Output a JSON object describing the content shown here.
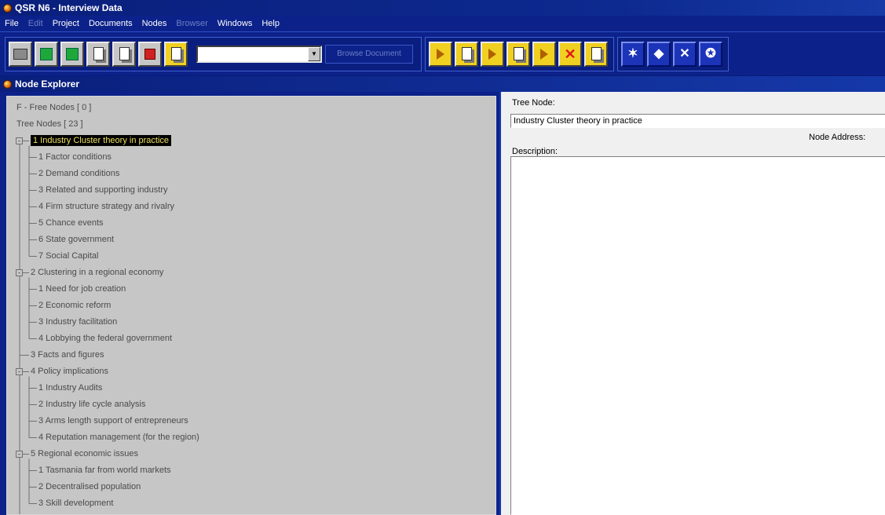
{
  "window": {
    "title": "QSR N6 - Interview Data"
  },
  "menu": [
    {
      "label": "File",
      "enabled": true
    },
    {
      "label": "Edit",
      "enabled": false
    },
    {
      "label": "Project",
      "enabled": true
    },
    {
      "label": "Documents",
      "enabled": true
    },
    {
      "label": "Nodes",
      "enabled": true
    },
    {
      "label": "Browser",
      "enabled": false
    },
    {
      "label": "Windows",
      "enabled": true
    },
    {
      "label": "Help",
      "enabled": true
    }
  ],
  "toolbar": {
    "document_combo_value": "",
    "browse_button_label": "Browse Document"
  },
  "explorer": {
    "title": "Node Explorer",
    "free_nodes": "F - Free Nodes [ 0 ]",
    "tree_nodes": "Tree Nodes [ 23 ]",
    "tree": [
      {
        "label": "1  Industry Cluster theory in practice",
        "level": 0,
        "expander": "-",
        "selected": true
      },
      {
        "label": "1  Factor conditions",
        "level": 1
      },
      {
        "label": "2  Demand conditions",
        "level": 1
      },
      {
        "label": "3  Related and supporting industry",
        "level": 1
      },
      {
        "label": "4  Firm structure strategy and rivalry",
        "level": 1
      },
      {
        "label": "5  Chance events",
        "level": 1
      },
      {
        "label": "6  State government",
        "level": 1
      },
      {
        "label": "7  Social Capital",
        "level": 1
      },
      {
        "label": "2  Clustering in a regional economy",
        "level": 0,
        "expander": "-"
      },
      {
        "label": "1  Need for job creation",
        "level": 1
      },
      {
        "label": "2  Economic reform",
        "level": 1
      },
      {
        "label": "3  Industry facilitation",
        "level": 1
      },
      {
        "label": "4  Lobbying the federal government",
        "level": 1
      },
      {
        "label": "3  Facts and figures",
        "level": 0
      },
      {
        "label": "4  Policy implications",
        "level": 0,
        "expander": "-"
      },
      {
        "label": "1  Industry Audits",
        "level": 1
      },
      {
        "label": "2  Industry life cycle analysis",
        "level": 1
      },
      {
        "label": "3  Arms length support of entrepreneurs",
        "level": 1
      },
      {
        "label": "4  Reputation management (for the region)",
        "level": 1
      },
      {
        "label": "5  Regional economic issues",
        "level": 0,
        "expander": "-"
      },
      {
        "label": "1  Tasmania far from world markets",
        "level": 1
      },
      {
        "label": "2  Decentralised population",
        "level": 1
      },
      {
        "label": "3  Skill development",
        "level": 1
      }
    ]
  },
  "detail": {
    "tree_node_label": "Tree Node:",
    "tree_node_value": "Industry Cluster theory in practice",
    "node_address_label": "Node Address:",
    "description_label": "Description:"
  }
}
